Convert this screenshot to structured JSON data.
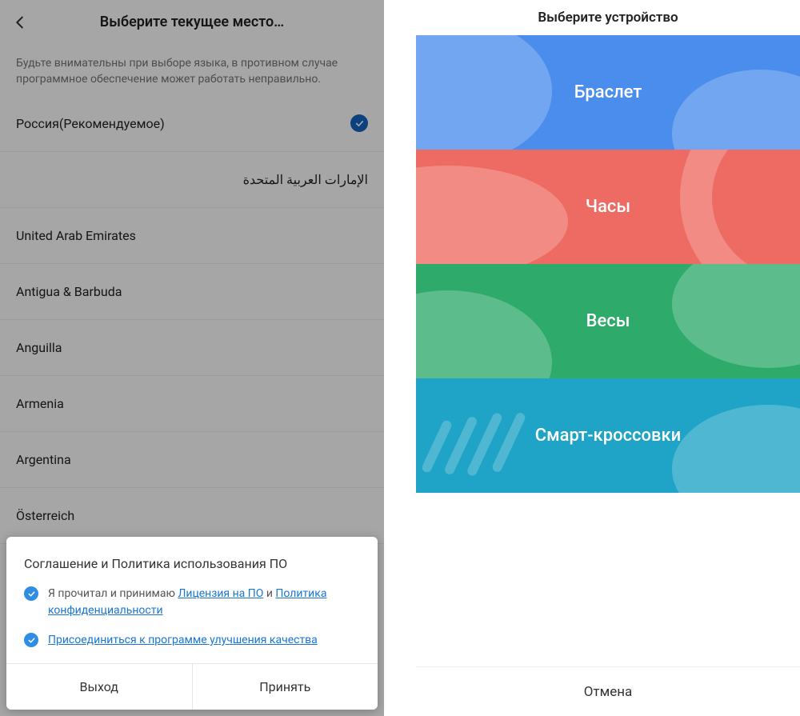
{
  "left": {
    "title": "Выберите текущее место…",
    "warning": "Будьте внимательны при выборе языка, в противном случае программное обеспечение может работать неправильно.",
    "countries": [
      {
        "name": "Россия(Рекомендуемое)",
        "selected": true
      },
      {
        "name": "الإمارات العربية المتحدة",
        "rtl": true
      },
      {
        "name": "United Arab Emirates"
      },
      {
        "name": "Antigua & Barbuda"
      },
      {
        "name": "Anguilla"
      },
      {
        "name": "Armenia"
      },
      {
        "name": "Argentina"
      },
      {
        "name": "Österreich"
      }
    ],
    "modal": {
      "title": "Соглашение и Политика использования ПО",
      "line1_prefix": "Я прочитал и принимаю ",
      "license_link": "Лицензия на ПО",
      "line1_mid": " и ",
      "privacy_link": "Политика конфиденциальности",
      "line2_link": "Присоединиться к программе улучшения качества",
      "exit": "Выход",
      "accept": "Принять"
    }
  },
  "right": {
    "title": "Выберите устройство",
    "tiles": {
      "band": "Браслет",
      "watch": "Часы",
      "scale": "Весы",
      "shoe": "Смарт-кроссовки"
    },
    "cancel": "Отмена"
  }
}
